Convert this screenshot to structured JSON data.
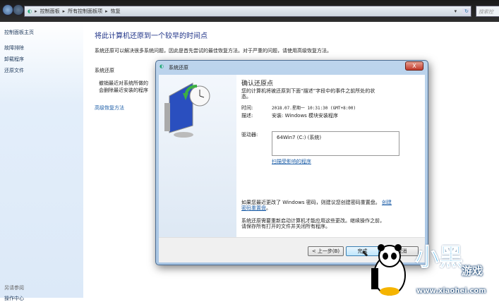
{
  "address": {
    "crumbs": [
      "控制面板",
      "所有控制面板项",
      "恢复"
    ],
    "search_placeholder": "搜索控"
  },
  "sidebar": {
    "items": [
      "控制面板主页",
      "故障排除",
      "卸载程序",
      "还原文件"
    ],
    "see_also": "另请参阅",
    "bottom_item": "操作中心"
  },
  "main": {
    "title": "将此计算机还原到一个较早的时间点",
    "desc": "系统还原可以解决很多系统问题，因此是首先尝试的最佳恢复方法。对于严重的问题，请使用高级恢复方法。",
    "section": "系统还原",
    "section_text1": "撤销最近对系统所做的",
    "section_text2": "会删除最近安装的程序",
    "advanced_link": "高级恢复方法"
  },
  "dialog": {
    "title": "系统还原",
    "close": "X",
    "heading": "确认还原点",
    "subtitle1": "您的计算机将被还原到下面“描述”字段中的事件之前所处的状",
    "subtitle2": "态。",
    "time_label": "时间:",
    "time_value": "2018.07.星期一 10:31:30 (GMT+8:00)",
    "desc_label": "描述:",
    "desc_value": "安装: Windows 模块安装程序",
    "drive_label": "驱动器:",
    "drive_value": "64Win7 (C:) (系统)",
    "scan_link": "扫描受影响的程序",
    "pwd_text1": "如果您最近更改了 Windows 密码，则建议您创建密码重置盘。",
    "pwd_link1": "创建",
    "pwd_link2": "密码重置盘",
    "pwd_text2": "。",
    "restart_text1": "系统还原需要重新启动计算机才能应用这些更改。继续操作之前，",
    "restart_text2": "请保存所有打开的文件并关闭所有程序。",
    "back": "< 上一步(B)",
    "finish": "完成",
    "cancel": "取消"
  },
  "watermark": {
    "brand": "小黑游戏",
    "url": "www.xiaohei.com"
  }
}
